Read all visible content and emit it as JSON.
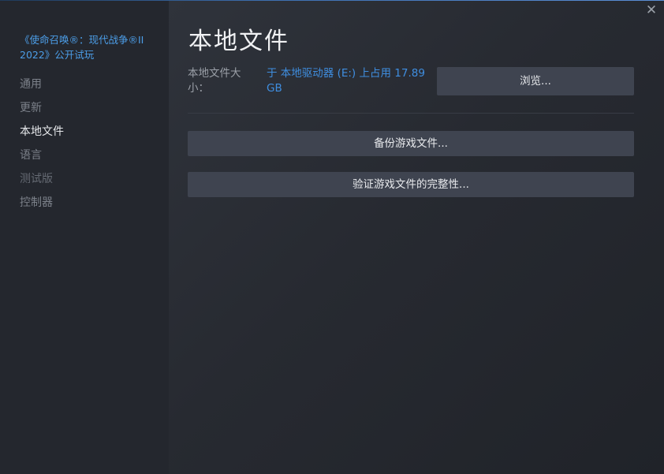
{
  "colors": {
    "accent": "#4c9ee8",
    "link": "#3f8ee0",
    "sidebar_bg": "#24272e",
    "button_bg": "#3f4450"
  },
  "sidebar": {
    "game_title": "《使命召唤®：现代战争®II 2022》公开试玩",
    "items": [
      {
        "label": "通用",
        "active": false
      },
      {
        "label": "更新",
        "active": false
      },
      {
        "label": "本地文件",
        "active": true
      },
      {
        "label": "语言",
        "active": false
      },
      {
        "label": "测试版",
        "active": false
      },
      {
        "label": "控制器",
        "active": false
      }
    ]
  },
  "window": {
    "close_icon": "close-icon",
    "close_glyph": "✕"
  },
  "main": {
    "title": "本地文件",
    "size_label": "本地文件大小：",
    "size_value": "于 本地驱动器 (E:) 上占用 17.89 GB",
    "browse_label": "浏览...",
    "backup_label": "备份游戏文件...",
    "verify_label": "验证游戏文件的完整性..."
  }
}
